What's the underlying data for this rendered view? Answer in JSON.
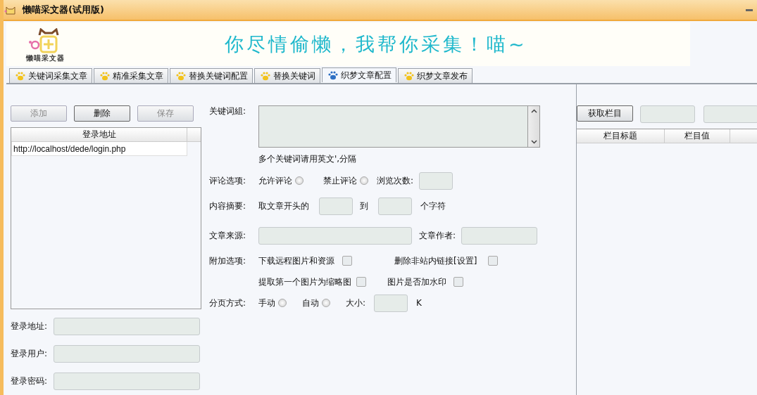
{
  "window": {
    "title": "懒喵采文器(试用版)"
  },
  "banner": {
    "logo_text": "懒喵采文器",
    "slogan": "你尽情偷懒，我帮你采集！喵~"
  },
  "tabs": [
    {
      "label": "关键词采集文章",
      "selected": false
    },
    {
      "label": "精准采集文章",
      "selected": false
    },
    {
      "label": "替换关键词配置",
      "selected": false
    },
    {
      "label": "替换关键词",
      "selected": false
    },
    {
      "label": "织梦文章配置",
      "selected": true
    },
    {
      "label": "织梦文章发布",
      "selected": false
    }
  ],
  "login_panel": {
    "buttons": [
      {
        "label": "添加",
        "disabled": true
      },
      {
        "label": "删除",
        "disabled": false
      },
      {
        "label": "保存",
        "disabled": true
      }
    ],
    "table": {
      "columns": [
        "登录地址"
      ],
      "rows": [
        [
          "http://localhost/dede/login.php"
        ]
      ]
    },
    "fields": [
      {
        "label": "登录地址:"
      },
      {
        "label": "登录用户:"
      },
      {
        "label": "登录密码:"
      }
    ]
  },
  "config": {
    "keywords": {
      "label": "关键词組:",
      "hint": "多个关键词请用英文',分隔"
    },
    "comment": {
      "label": "评论选项:",
      "options": [
        {
          "label": "允许评论",
          "selected": false
        },
        {
          "label": "禁止评论",
          "selected": false
        }
      ],
      "views_label": "浏览次数:"
    },
    "summary": {
      "label": "内容摘要:",
      "prefix": "取文章开头的",
      "middle": "到",
      "suffix": "个字符"
    },
    "source": {
      "label": "文章来源:",
      "author_label": "文章作者:"
    },
    "extras": {
      "label": "附加选项:",
      "options": [
        {
          "label": "下载远程图片和资源",
          "checked": false
        },
        {
          "label": "删除非站内链接[设置]",
          "checked": false
        },
        {
          "label": "提取第一个图片为缩略图",
          "checked": false
        },
        {
          "label": "图片是否加水印",
          "checked": false
        }
      ]
    },
    "paging": {
      "label": "分页方式:",
      "options": [
        {
          "label": "手动",
          "selected": false
        },
        {
          "label": "自动",
          "selected": false
        }
      ],
      "size_label": "大小:",
      "unit": "K"
    }
  },
  "category_panel": {
    "button": "获取栏目",
    "table": {
      "columns": [
        "栏目标题",
        "栏目值"
      ]
    }
  }
}
